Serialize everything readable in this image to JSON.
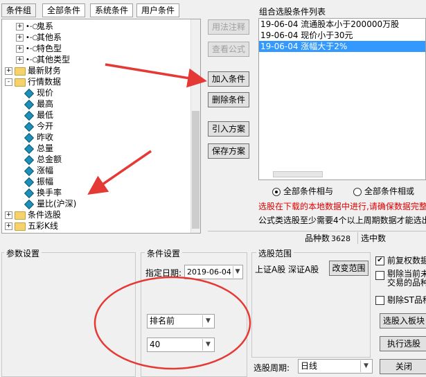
{
  "tabs": [
    "条件组",
    "全部条件",
    "系统条件",
    "用户条件"
  ],
  "tree": [
    {
      "label": "鬼系",
      "kind": "key",
      "level": 1
    },
    {
      "label": "其他系",
      "kind": "key",
      "level": 1
    },
    {
      "label": "特色型",
      "kind": "key",
      "level": 1
    },
    {
      "label": "其他类型",
      "kind": "key",
      "level": 1
    },
    {
      "label": "最新财务",
      "kind": "folder",
      "level": 0,
      "expander": "+"
    },
    {
      "label": "行情数据",
      "kind": "folder",
      "level": 0,
      "expander": "-"
    },
    {
      "label": "现价",
      "kind": "item",
      "level": 1
    },
    {
      "label": "最高",
      "kind": "item",
      "level": 1
    },
    {
      "label": "最低",
      "kind": "item",
      "level": 1
    },
    {
      "label": "今开",
      "kind": "item",
      "level": 1
    },
    {
      "label": "昨收",
      "kind": "item",
      "level": 1
    },
    {
      "label": "总量",
      "kind": "item",
      "level": 1
    },
    {
      "label": "总金额",
      "kind": "item",
      "level": 1
    },
    {
      "label": "涨幅",
      "kind": "item",
      "level": 1
    },
    {
      "label": "振幅",
      "kind": "item",
      "level": 1
    },
    {
      "label": "换手率",
      "kind": "item",
      "level": 1
    },
    {
      "label": "量比(沪深)",
      "kind": "item",
      "level": 1
    },
    {
      "label": "条件选股",
      "kind": "folder",
      "level": 0,
      "expander": "+"
    },
    {
      "label": "五彩K线",
      "kind": "folder",
      "level": 0,
      "expander": "+"
    }
  ],
  "buttons": {
    "formula_note": "用法注释",
    "view_formula": "查看公式",
    "add_condition": "加入条件",
    "delete_condition": "删除条件",
    "import_plan": "引入方案",
    "save_plan": "保存方案",
    "change_range": "改变范围",
    "select_to_block": "选股入板块",
    "execute": "执行选股",
    "close": "关闭"
  },
  "combo_list": {
    "title": "组合选股条件列表",
    "items": [
      "19-06-04 流通股本小于200000万股",
      "19-06-04 现价小于30元",
      "19-06-04 涨幅大于2%"
    ],
    "selected_index": 2
  },
  "logic": {
    "all_and": "全部条件相与",
    "all_or": "全部条件相或",
    "selected": "and"
  },
  "warning_text": "选股在下载的本地数据中进行,请确保数据完整",
  "info_text": "公式类选股至少需要4个以上周期数据才能选出",
  "status": {
    "count_label": "品种数",
    "count_value": "3628",
    "selected_label": "选中数"
  },
  "params": {
    "title": "参数设置"
  },
  "condition_settings": {
    "title": "条件设置",
    "date_label": "指定日期:",
    "date_value": "2019-06-04",
    "rank_value": "排名前",
    "rank_count": "40"
  },
  "range": {
    "title": "选股范围",
    "markets": "上证A股 深证A股",
    "period_label": "选股周期:",
    "period_value": "日线"
  },
  "options": [
    {
      "label": "前复权数据",
      "checked": true
    },
    {
      "label": "剔除当前未\n交易的品种",
      "checked": false
    },
    {
      "label": "剔除ST品种",
      "checked": false
    }
  ],
  "colors": {
    "warning": "#e00000",
    "annotation": "#e53935",
    "selection": "#3399ff"
  }
}
